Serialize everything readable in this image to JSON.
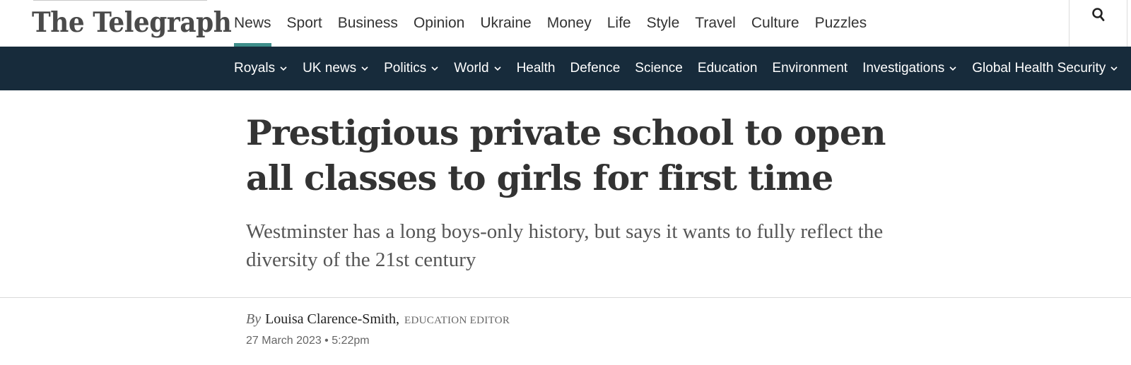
{
  "masthead": {
    "logo_text": "The Telegraph"
  },
  "primary_nav": {
    "items": [
      {
        "label": "News",
        "active": true
      },
      {
        "label": "Sport"
      },
      {
        "label": "Business"
      },
      {
        "label": "Opinion"
      },
      {
        "label": "Ukraine"
      },
      {
        "label": "Money"
      },
      {
        "label": "Life"
      },
      {
        "label": "Style"
      },
      {
        "label": "Travel"
      },
      {
        "label": "Culture"
      },
      {
        "label": "Puzzles"
      }
    ],
    "search_icon": "search-icon",
    "active_color": "#3e8e8a"
  },
  "sub_nav": {
    "background": "#172b3b",
    "items": [
      {
        "label": "Royals",
        "has_dropdown": true
      },
      {
        "label": "UK news",
        "has_dropdown": true
      },
      {
        "label": "Politics",
        "has_dropdown": true
      },
      {
        "label": "World",
        "has_dropdown": true
      },
      {
        "label": "Health",
        "has_dropdown": false
      },
      {
        "label": "Defence",
        "has_dropdown": false
      },
      {
        "label": "Science",
        "has_dropdown": false
      },
      {
        "label": "Education",
        "has_dropdown": false
      },
      {
        "label": "Environment",
        "has_dropdown": false
      },
      {
        "label": "Investigations",
        "has_dropdown": true
      },
      {
        "label": "Global Health Security",
        "has_dropdown": true
      }
    ]
  },
  "article": {
    "headline": "Prestigious private school to open all classes to girls for first time",
    "standfirst": "Westminster has a long boys-only history, but says it wants to fully reflect the diversity of the 21st century",
    "byline_prefix": "By",
    "author": "Louisa Clarence-Smith,",
    "author_role": "EDUCATION EDITOR",
    "date": "27 March 2023 • 5:22pm"
  }
}
